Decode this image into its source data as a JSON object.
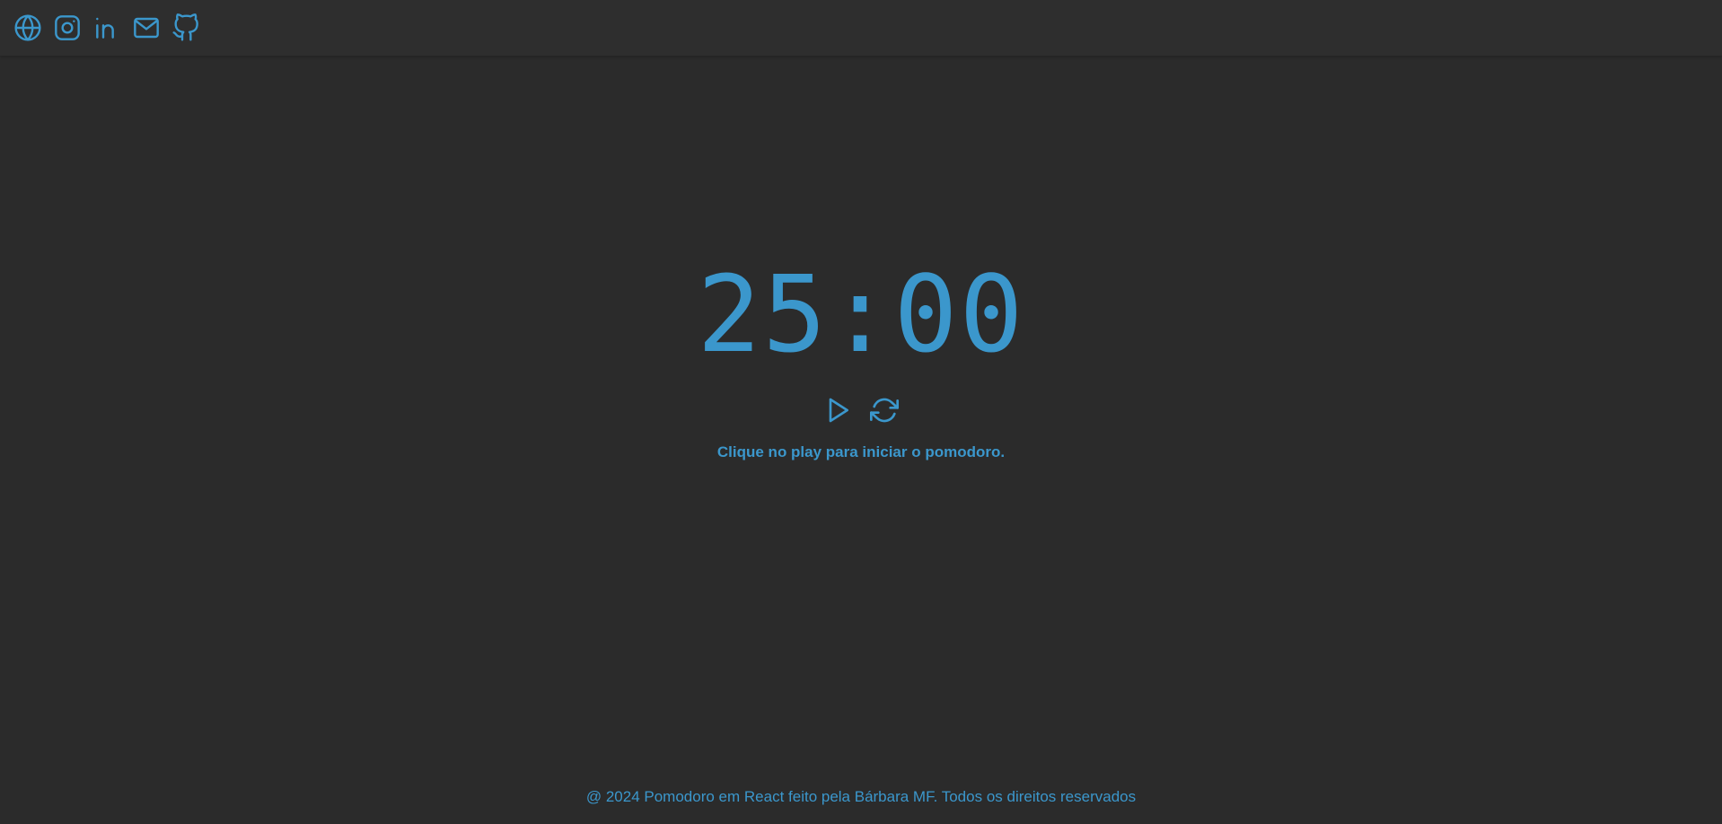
{
  "header": {
    "social_links": [
      {
        "icon": "globe-icon",
        "label": "Website"
      },
      {
        "icon": "instagram-icon",
        "label": "Instagram"
      },
      {
        "icon": "linkedin-icon",
        "label": "LinkedIn"
      },
      {
        "icon": "mail-icon",
        "label": "Email"
      },
      {
        "icon": "github-icon",
        "label": "GitHub"
      }
    ]
  },
  "timer": {
    "display": "25:00"
  },
  "controls": {
    "play_icon": "play-icon",
    "reset_icon": "refresh-icon"
  },
  "hint": "Clique no play para iniciar o pomodoro.",
  "footer": {
    "text": "@ 2024 Pomodoro em React feito pela Bárbara MF. Todos os direitos reservados"
  },
  "colors": {
    "background": "#2b2b2b",
    "header_background": "#2e2e2e",
    "accent": "#3b97cc"
  }
}
